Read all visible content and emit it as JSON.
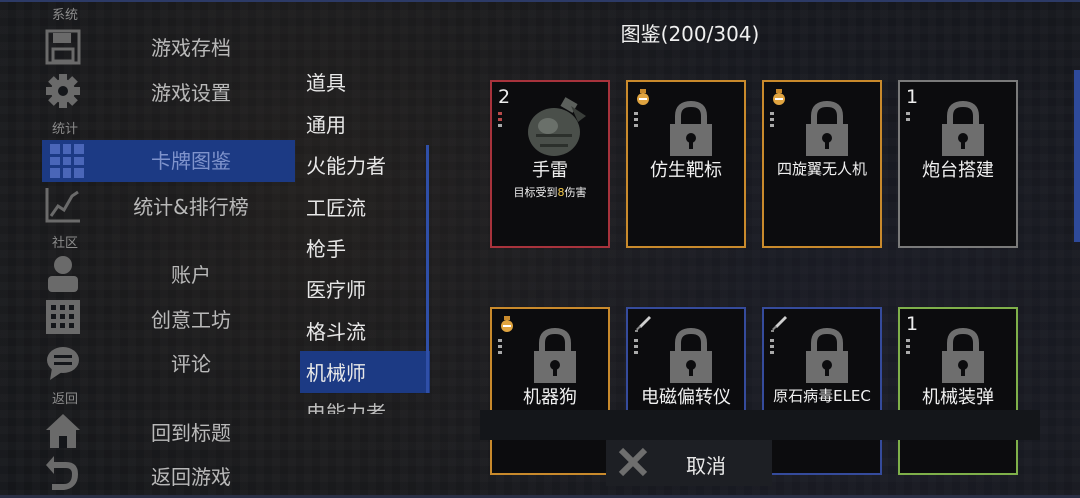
{
  "sidebar": {
    "sections": {
      "system": "系统",
      "stats": "统计",
      "community": "社区",
      "back": "返回"
    },
    "items": [
      {
        "label": "游戏存档",
        "icon": "save-icon"
      },
      {
        "label": "游戏设置",
        "icon": "gear-icon"
      },
      {
        "label": "卡牌图鉴",
        "icon": "grid-icon",
        "selected": true
      },
      {
        "label": "统计&排行榜",
        "icon": "chart-icon"
      },
      {
        "label": "账户",
        "icon": "user-icon"
      },
      {
        "label": "创意工坊",
        "icon": "workshop-icon"
      },
      {
        "label": "评论",
        "icon": "comment-icon"
      },
      {
        "label": "回到标题",
        "icon": "home-icon"
      },
      {
        "label": "返回游戏",
        "icon": "return-icon"
      }
    ]
  },
  "categories": [
    "道具",
    "通用",
    "火能力者",
    "工匠流",
    "枪手",
    "医疗师",
    "格斗流",
    "机械师",
    "电能力者"
  ],
  "selected_category": "机械师",
  "gallery": {
    "title": "图鉴(200/304)"
  },
  "cards": [
    {
      "name": "手雷",
      "count": "2",
      "desc_pre": "目标受到",
      "desc_hl": "8",
      "desc_post": "伤害",
      "rarity_color": "#a8333c",
      "locked": false,
      "type_icon": ""
    },
    {
      "name": "仿生靶标",
      "count": "",
      "rarity_color": "#c98a2c",
      "locked": true,
      "type_icon": "potion-icon"
    },
    {
      "name": "四旋翼无人机",
      "count": "",
      "rarity_color": "#c98a2c",
      "locked": true,
      "type_icon": "potion-icon"
    },
    {
      "name": "炮台搭建",
      "count": "1",
      "rarity_color": "#7a7a7a",
      "locked": true,
      "type_icon": ""
    },
    {
      "name": "机器狗",
      "count": "",
      "rarity_color": "#c98a2c",
      "locked": true,
      "type_icon": "potion-icon"
    },
    {
      "name": "电磁偏转仪",
      "count": "",
      "rarity_color": "#354b9c",
      "locked": true,
      "type_icon": "sword-icon"
    },
    {
      "name": "原石病毒ELEC",
      "count": "",
      "rarity_color": "#354b9c",
      "locked": true,
      "type_icon": "sword-icon"
    },
    {
      "name": "机械装弹",
      "count": "1",
      "rarity_color": "#7fb04a",
      "locked": true,
      "type_icon": ""
    }
  ],
  "cancel_label": "取消"
}
